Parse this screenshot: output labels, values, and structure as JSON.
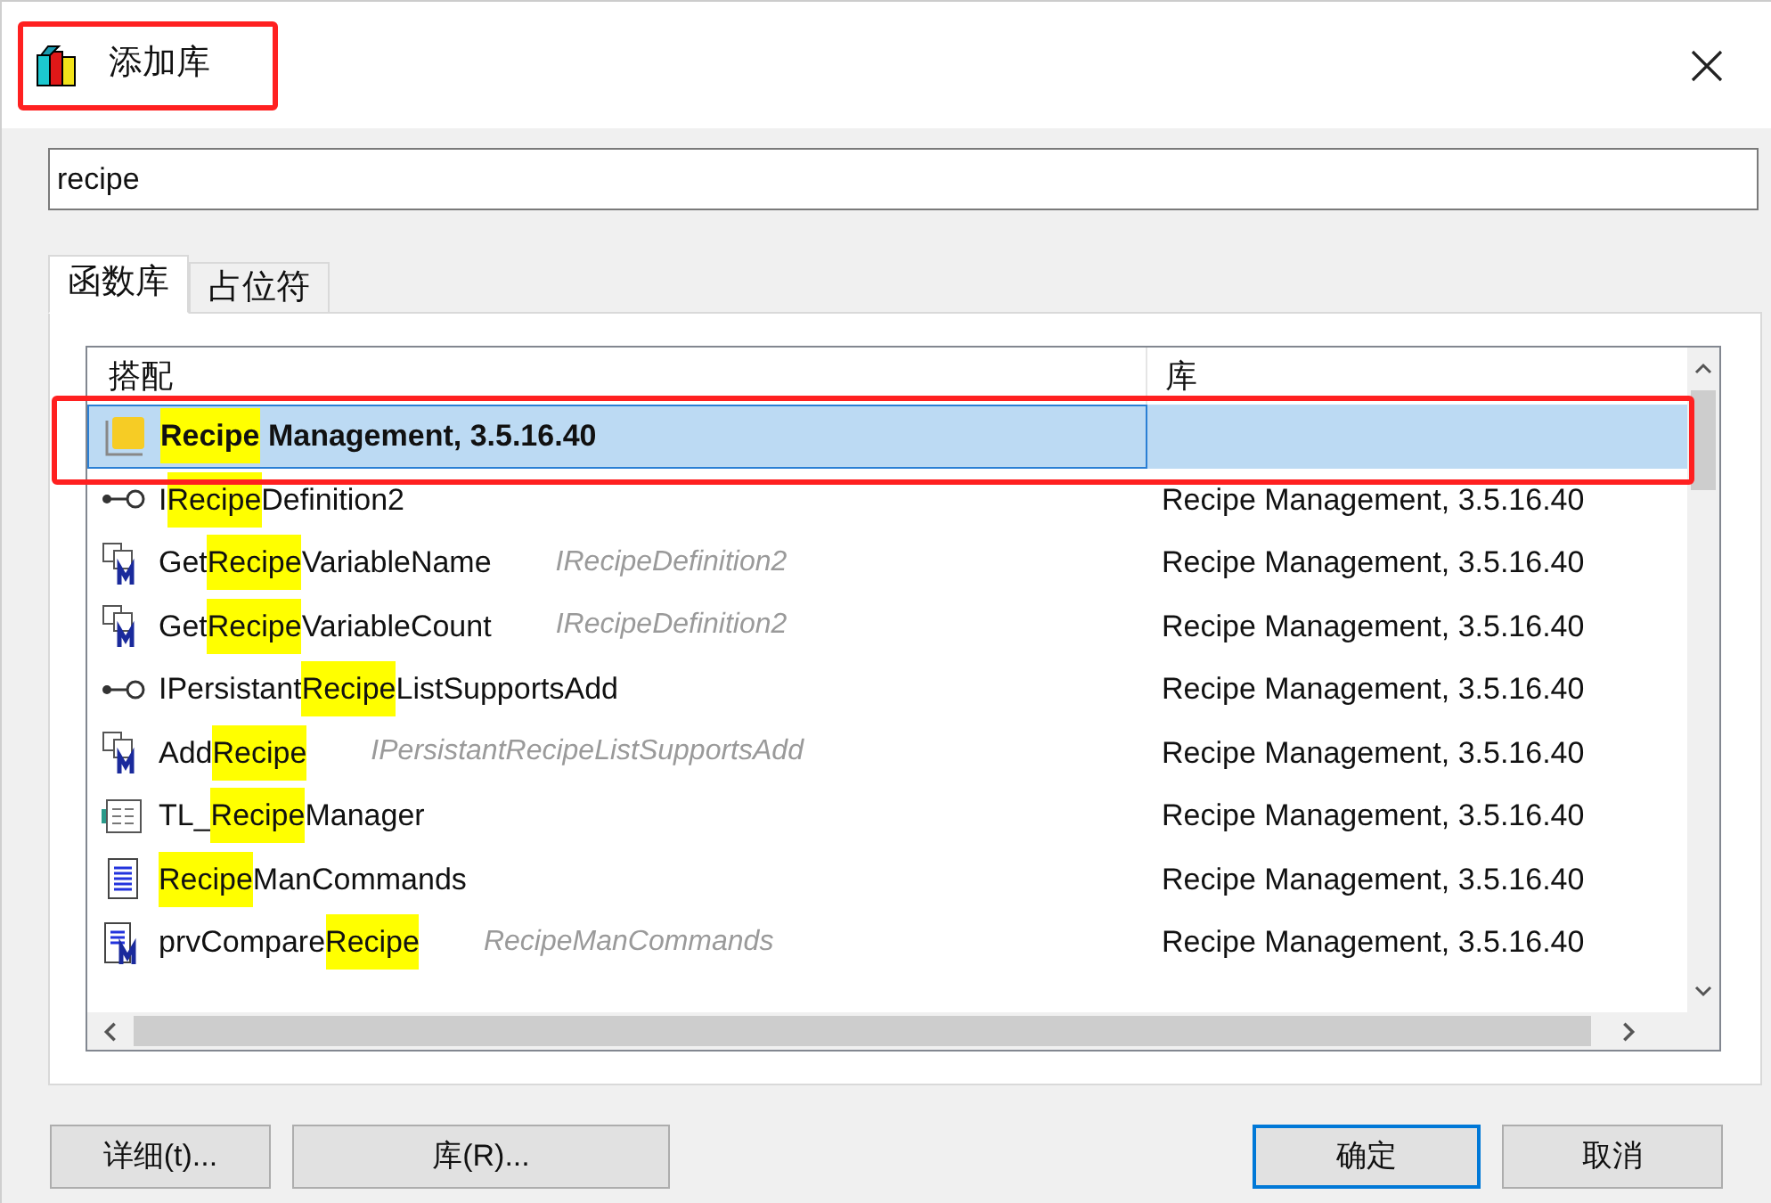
{
  "window": {
    "title": "添加库"
  },
  "search": {
    "value": "recipe"
  },
  "tabs": [
    {
      "label": "函数库",
      "selected": true
    },
    {
      "label": "占位符",
      "selected": false
    }
  ],
  "table": {
    "columns": [
      "搭配",
      "库"
    ],
    "rows": [
      {
        "kind": "library",
        "selected": true,
        "parts": [
          {
            "text": "Recipe",
            "highlight": true
          },
          {
            "text": " Management, 3.5.16.40",
            "highlight": false
          }
        ]
      },
      {
        "kind": "interface",
        "selected": false,
        "parts": [
          {
            "text": "I",
            "highlight": false
          },
          {
            "text": "Recipe",
            "highlight": true
          },
          {
            "text": "Definition2",
            "highlight": false
          }
        ],
        "library": "Recipe Management, 3.5.16.40"
      },
      {
        "kind": "method",
        "selected": false,
        "parts": [
          {
            "text": "Get",
            "highlight": false
          },
          {
            "text": "Recipe",
            "highlight": true
          },
          {
            "text": "VariableName",
            "highlight": false
          }
        ],
        "owner": "IRecipeDefinition2",
        "library": "Recipe Management, 3.5.16.40"
      },
      {
        "kind": "method",
        "selected": false,
        "parts": [
          {
            "text": "Get",
            "highlight": false
          },
          {
            "text": "Recipe",
            "highlight": true
          },
          {
            "text": "VariableCount",
            "highlight": false
          }
        ],
        "owner": "IRecipeDefinition2",
        "library": "Recipe Management, 3.5.16.40"
      },
      {
        "kind": "interface",
        "selected": false,
        "parts": [
          {
            "text": "IPersistant",
            "highlight": false
          },
          {
            "text": "Recipe",
            "highlight": true
          },
          {
            "text": "ListSupportsAdd",
            "highlight": false
          }
        ],
        "library": "Recipe Management, 3.5.16.40"
      },
      {
        "kind": "method",
        "selected": false,
        "parts": [
          {
            "text": "Add",
            "highlight": false
          },
          {
            "text": "Recipe",
            "highlight": true
          }
        ],
        "owner": "IPersistantRecipeListSupportsAdd",
        "library": "Recipe Management, 3.5.16.40"
      },
      {
        "kind": "gvl",
        "selected": false,
        "parts": [
          {
            "text": "TL_",
            "highlight": false
          },
          {
            "text": "Recipe",
            "highlight": true
          },
          {
            "text": "Manager",
            "highlight": false
          }
        ],
        "library": "Recipe Management, 3.5.16.40"
      },
      {
        "kind": "pou",
        "selected": false,
        "parts": [
          {
            "text": "Recipe",
            "highlight": true
          },
          {
            "text": "ManCommands",
            "highlight": false
          }
        ],
        "library": "Recipe Management, 3.5.16.40"
      },
      {
        "kind": "pou-method",
        "selected": false,
        "parts": [
          {
            "text": "prvCompare",
            "highlight": false
          },
          {
            "text": "Recipe",
            "highlight": true
          }
        ],
        "owner": "RecipeManCommands",
        "library": "Recipe Management, 3.5.16.40"
      }
    ]
  },
  "buttons": [
    {
      "label": "详细(t)...",
      "kind": "secondary"
    },
    {
      "label": "库(R)...",
      "kind": "wide"
    },
    {
      "label": "确定",
      "kind": "default"
    },
    {
      "label": "取消",
      "kind": "secondary"
    }
  ]
}
